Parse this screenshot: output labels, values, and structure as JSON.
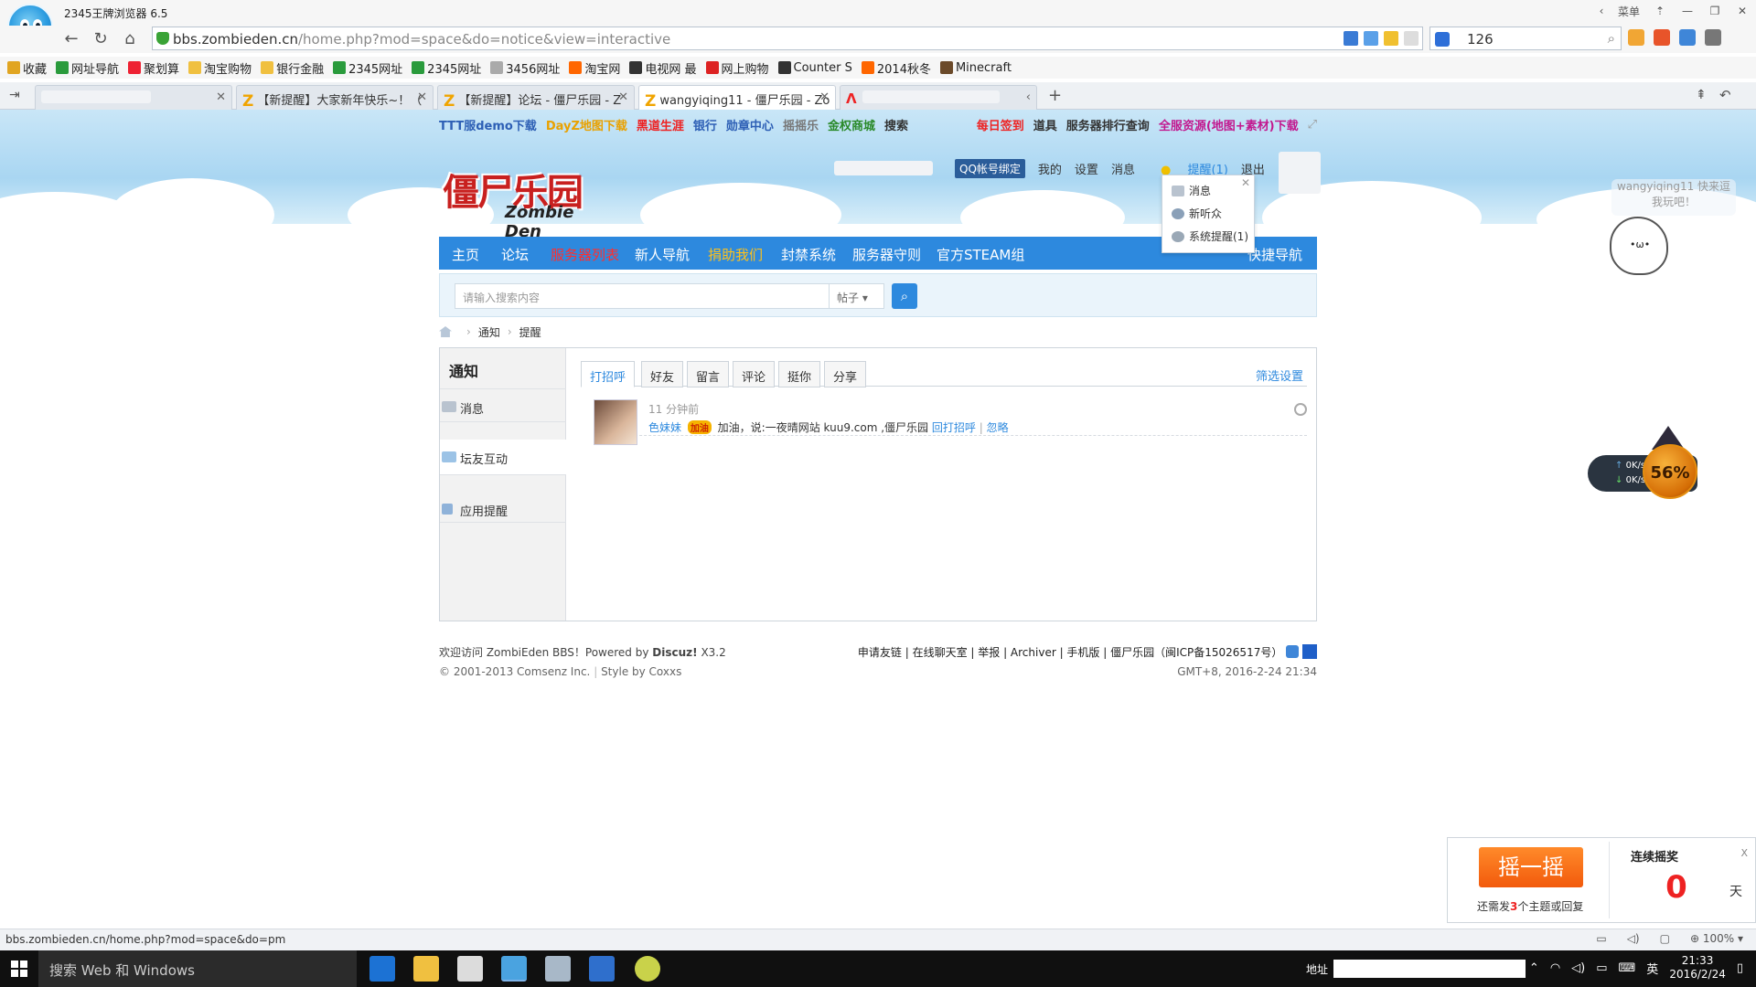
{
  "browser": {
    "title": "2345王牌浏览器 6.5",
    "menu_label": "菜单",
    "url_domain": "bbs.zombieden.cn",
    "url_path": "/home.php?mod=space&do=notice&view=interactive",
    "search_value": "126",
    "status_url": "bbs.zombieden.cn/home.php?mod=space&do=pm",
    "zoom": "100%"
  },
  "bookmarks": [
    {
      "label": "收藏",
      "color": "#e1a521"
    },
    {
      "label": "网址导航",
      "color": "#2a9b3c"
    },
    {
      "label": "聚划算",
      "color": "#e23"
    },
    {
      "label": "淘宝购物",
      "color": "#f0c040"
    },
    {
      "label": "银行金融",
      "color": "#f0c040"
    },
    {
      "label": "2345网址",
      "color": "#2a9b3c"
    },
    {
      "label": "2345网址",
      "color": "#2a9b3c"
    },
    {
      "label": "3456网址",
      "color": "#aaa"
    },
    {
      "label": "淘宝网",
      "color": "#f60"
    },
    {
      "label": "电视网 最",
      "color": "#333"
    },
    {
      "label": "网上购物",
      "color": "#d22"
    },
    {
      "label": "Counter S",
      "color": "#333"
    },
    {
      "label": "2014秋冬",
      "color": "#f60"
    },
    {
      "label": "Minecraft",
      "color": "#6b4a2a"
    }
  ],
  "tabs": [
    {
      "label": "",
      "active": false
    },
    {
      "label": "【新提醒】大家新年快乐~！（",
      "active": false
    },
    {
      "label": "【新提醒】论坛 - 僵尸乐园 - Z",
      "active": false
    },
    {
      "label": "wangyiqing11 - 僵尸乐园 - Zo",
      "active": true
    },
    {
      "label": "",
      "active": false
    }
  ],
  "topnav_left": [
    {
      "label": "TTT服demo下载",
      "color": "#2d5fb5"
    },
    {
      "label": "DayZ地图下载",
      "color": "#e9a100"
    },
    {
      "label": "黑道生涯",
      "color": "#e22"
    },
    {
      "label": "银行",
      "color": "#2d5fb5"
    },
    {
      "label": "勋章中心",
      "color": "#2d5fb5"
    },
    {
      "label": "摇摇乐",
      "color": "#777"
    },
    {
      "label": "金权商城",
      "color": "#2a8a2a"
    },
    {
      "label": "搜索",
      "color": "#333"
    }
  ],
  "topnav_right": [
    {
      "label": "每日签到",
      "color": "#e22"
    },
    {
      "label": "道具",
      "color": "#333"
    },
    {
      "label": "服务器排行查询",
      "color": "#333"
    },
    {
      "label": "全服资源(地图+素材)下载",
      "color": "#c2188f"
    }
  ],
  "logo": {
    "cn": "僵尸乐园",
    "en": "Zombie Den"
  },
  "userbar": {
    "qq_bind": "QQ帐号绑定",
    "mine": "我的",
    "settings": "设置",
    "messages": "消息",
    "reminders": "提醒(1)",
    "logout": "退出"
  },
  "popup": {
    "items": [
      "消息",
      "新听众",
      "系统提醒(1)"
    ]
  },
  "mainnav": [
    {
      "label": "主页",
      "color": "#fff"
    },
    {
      "label": "论坛",
      "color": "#fff"
    },
    {
      "label": "服务器列表",
      "color": "#ff2e2e"
    },
    {
      "label": "新人导航",
      "color": "#fff"
    },
    {
      "label": "捐助我们",
      "color": "#ffc21a"
    },
    {
      "label": "封禁系统",
      "color": "#fff"
    },
    {
      "label": "服务器守则",
      "color": "#fff"
    },
    {
      "label": "官方STEAM组",
      "color": "#fff"
    },
    {
      "label": "快捷导航",
      "color": "#fff"
    }
  ],
  "search": {
    "placeholder": "请输入搜索内容",
    "type": "帖子"
  },
  "breadcrumb": [
    "通知",
    "提醒"
  ],
  "sidebar": {
    "heading": "通知",
    "items": [
      "消息",
      "坛友互动",
      "应用提醒"
    ]
  },
  "content_tabs": [
    "打招呼",
    "好友",
    "留言",
    "评论",
    "挺你",
    "分享"
  ],
  "filter_label": "筛选设置",
  "notice": {
    "time": "11 分钟前",
    "user": "色妹妹",
    "badge": "加油",
    "text": "加油，说:一夜晴网站 kuu9.com ,僵尸乐园",
    "reply": "回打招呼",
    "ignore": "忽略"
  },
  "footer": {
    "welcome": "欢迎访问 ZombiEden BBS！Powered by",
    "discuz": "Discuz!",
    "version": "X3.2",
    "copyright": "© 2001-2013 Comsenz Inc.",
    "style": "Style by Coxxs",
    "links": "申请友链 | 在线聊天室 | 举报 | Archiver | 手机版 | 僵尸乐园（闽ICP备15026517号）",
    "time": "GMT+8, 2016-2-24 21:34"
  },
  "mascot": {
    "bubble": "wangyiqing11 快来逗我玩吧！"
  },
  "speed": {
    "up": "0K/s",
    "down": "0K/s",
    "percent": "56%"
  },
  "prize": {
    "button": "摇一摇",
    "note_pre": "还需发",
    "note_num": "3",
    "note_post": "个主题或回复",
    "heading": "连续摇奖",
    "count": "0",
    "unit": "天",
    "close": "X"
  },
  "taskbar": {
    "search": "搜索 Web 和 Windows",
    "address_label": "地址",
    "ime": "英",
    "time": "21:33",
    "date": "2016/2/24"
  }
}
